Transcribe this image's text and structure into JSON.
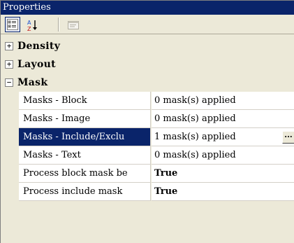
{
  "panel": {
    "title": "Properties"
  },
  "toolbar": {
    "buttons": [
      {
        "name": "categorized-view-button",
        "icon": "categorized-icon",
        "pressed": true
      },
      {
        "name": "alphabetical-sort-button",
        "icon": "sort-az-icon",
        "pressed": false
      },
      {
        "name": "property-pages-button",
        "icon": "property-pages-icon",
        "pressed": false
      }
    ],
    "sort_letters": {
      "top": "A",
      "bottom": "Z"
    }
  },
  "grid": {
    "categories": [
      {
        "label": "Density",
        "toggle": "+",
        "expanded": false
      },
      {
        "label": "Layout",
        "toggle": "+",
        "expanded": false
      },
      {
        "label": "Mask",
        "toggle": "−",
        "expanded": true
      }
    ],
    "mask_properties": [
      {
        "name": "Masks - Block",
        "value": "0 mask(s) applied",
        "bold": false,
        "selected": false
      },
      {
        "name": "Masks - Image",
        "value": "0 mask(s) applied",
        "bold": false,
        "selected": false
      },
      {
        "name": "Masks - Include/Exclu",
        "value": "1 mask(s) applied",
        "bold": false,
        "selected": true,
        "ellipsis": "..."
      },
      {
        "name": "Masks - Text",
        "value": "0 mask(s) applied",
        "bold": false,
        "selected": false
      },
      {
        "name": "Process block mask be",
        "value": "True",
        "bold": true,
        "selected": false
      },
      {
        "name": "Process include mask",
        "value": "True",
        "bold": true,
        "selected": false
      }
    ]
  },
  "colors": {
    "title_bg": "#0a246a",
    "selection_bg": "#0a246a",
    "grid_bg": "#ece9d8",
    "grid_line": "#d4d0c8"
  }
}
